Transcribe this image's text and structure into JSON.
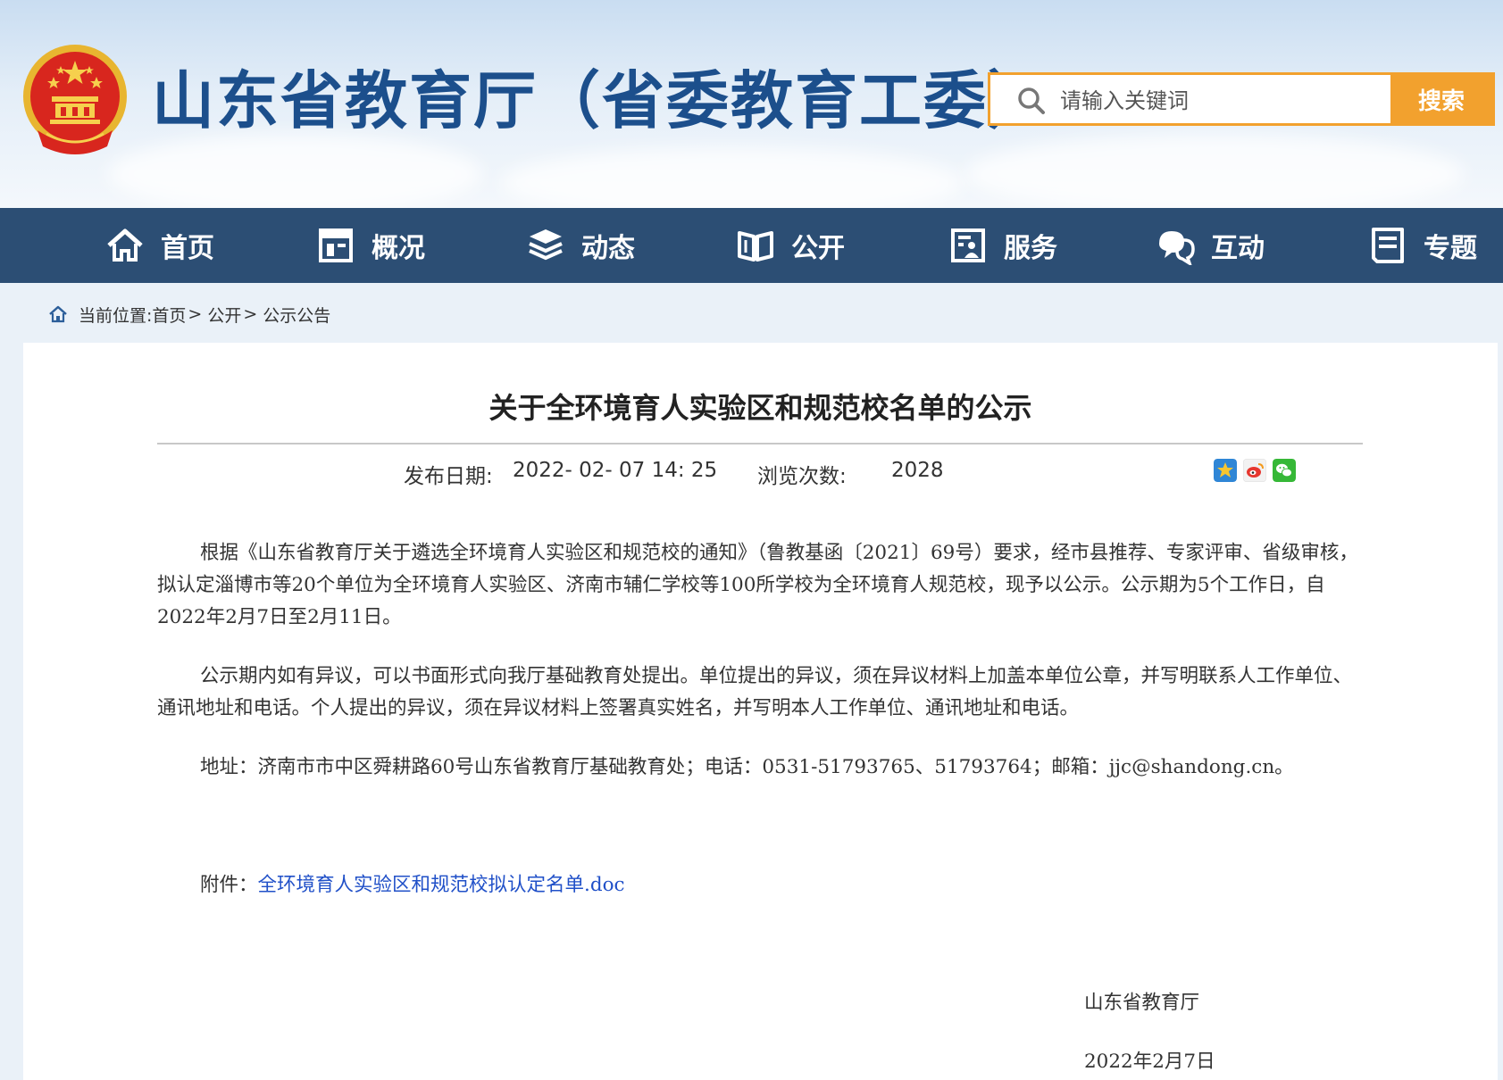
{
  "header": {
    "site_title": "山东省教育厅（省委教育工委）",
    "search_placeholder": "请输入关键词",
    "search_button": "搜索"
  },
  "nav": {
    "items": [
      {
        "label": "首页",
        "icon": "home-icon"
      },
      {
        "label": "概况",
        "icon": "overview-icon"
      },
      {
        "label": "动态",
        "icon": "news-icon"
      },
      {
        "label": "公开",
        "icon": "open-book-icon"
      },
      {
        "label": "服务",
        "icon": "service-icon"
      },
      {
        "label": "互动",
        "icon": "chat-icon"
      },
      {
        "label": "专题",
        "icon": "topic-icon"
      }
    ]
  },
  "breadcrumb": {
    "prefix": "当前位置:",
    "items": [
      "首页",
      "公开",
      "公示公告"
    ],
    "separator": ">"
  },
  "article": {
    "title": "关于全环境育人实验区和规范校名单的公示",
    "publish_label": "发布日期:",
    "publish_value": "2022- 02- 07 14: 25",
    "views_label": "浏览次数:",
    "views_value": "2028",
    "share_icons": [
      "qzone-icon",
      "weibo-icon",
      "wechat-icon"
    ],
    "paragraphs": [
      "根据《山东省教育厅关于遴选全环境育人实验区和规范校的通知》（鲁教基函〔2021〕69号）要求，经市县推荐、专家评审、省级审核，拟认定淄博市等20个单位为全环境育人实验区、济南市辅仁学校等100所学校为全环境育人规范校，现予以公示。公示期为5个工作日，自2022年2月7日至2月11日。",
      "公示期内如有异议，可以书面形式向我厅基础教育处提出。单位提出的异议，须在异议材料上加盖本单位公章，并写明联系人工作单位、通讯地址和电话。个人提出的异议，须在异议材料上签署真实姓名，并写明本人工作单位、通讯地址和电话。",
      "地址：济南市市中区舜耕路60号山东省教育厅基础教育处；电话：0531-51793765、51793764；邮箱：jjc@shandong.cn。"
    ],
    "attachment_label": "附件：",
    "attachment_link": "全环境育人实验区和规范校拟认定名单.doc",
    "signature_org": "山东省教育厅",
    "signature_date": "2022年2月7日"
  }
}
